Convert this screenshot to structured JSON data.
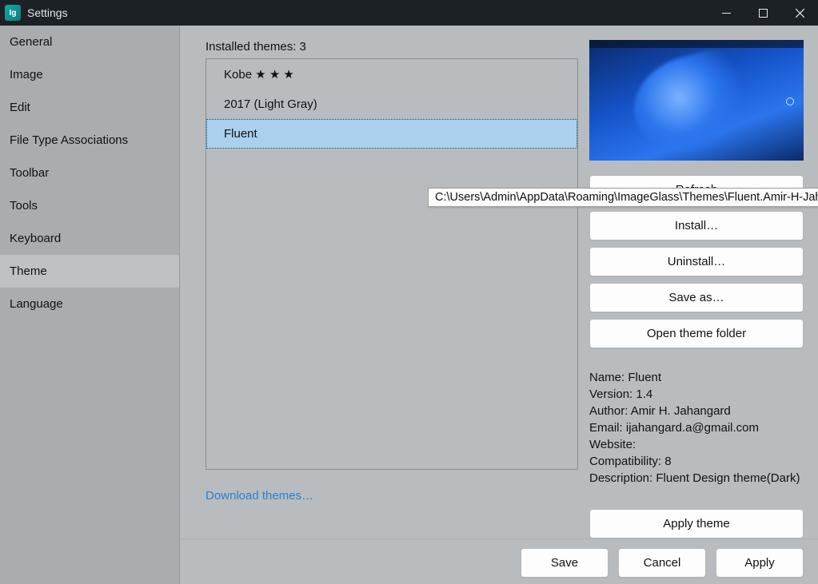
{
  "window": {
    "title": "Settings",
    "app_icon_text": "Ig"
  },
  "sidebar": {
    "items": [
      {
        "label": "General"
      },
      {
        "label": "Image"
      },
      {
        "label": "Edit"
      },
      {
        "label": "File Type Associations"
      },
      {
        "label": "Toolbar"
      },
      {
        "label": "Tools"
      },
      {
        "label": "Keyboard"
      },
      {
        "label": "Theme"
      },
      {
        "label": "Language"
      }
    ],
    "selected_index": 7
  },
  "themes_panel": {
    "installed_label": "Installed themes: 3",
    "items": [
      {
        "label": "Kobe ★ ★ ★"
      },
      {
        "label": "2017 (Light Gray)"
      },
      {
        "label": "Fluent"
      }
    ],
    "selected_index": 2,
    "tooltip_path": "C:\\Users\\Admin\\AppData\\Roaming\\ImageGlass\\Themes\\Fluent.Amir-H-Jahangard",
    "download_link": "Download themes…"
  },
  "actions": {
    "refresh": "Refresh",
    "install": "Install…",
    "uninstall": "Uninstall…",
    "save_as": "Save as…",
    "open_folder": "Open theme folder",
    "apply_theme": "Apply theme"
  },
  "theme_details": {
    "name_label": "Name:",
    "name_value": "Fluent",
    "version_label": "Version:",
    "version_value": "1.4",
    "author_label": "Author:",
    "author_value": "Amir H. Jahangard",
    "email_label": "Email:",
    "email_value": "ijahangard.a@gmail.com",
    "website_label": "Website:",
    "website_value": "",
    "compat_label": "Compatibility:",
    "compat_value": "8",
    "desc_label": "Description:",
    "desc_value": "Fluent Design theme(Dark)"
  },
  "footer": {
    "save": "Save",
    "cancel": "Cancel",
    "apply": "Apply"
  }
}
